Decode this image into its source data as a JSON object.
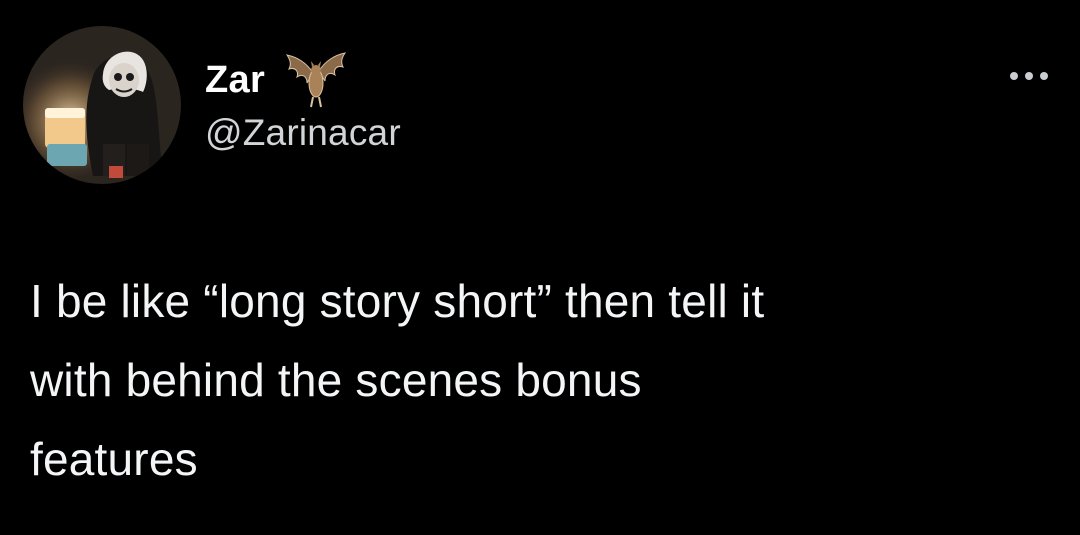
{
  "tweet": {
    "author": {
      "display_name": "Zar",
      "handle": "@Zarinacar",
      "avatar_icon": "profile-photo-skull-makeup-candle",
      "name_emoji_icon": "bat-icon"
    },
    "more_icon": "more-options-icon",
    "text_lines": [
      "I be like “long story short” then tell it",
      "with behind the scenes bonus",
      "features"
    ],
    "colors": {
      "background": "#000000",
      "primary_text": "#e7e9ea",
      "secondary_text": "#d2d5d8"
    }
  }
}
